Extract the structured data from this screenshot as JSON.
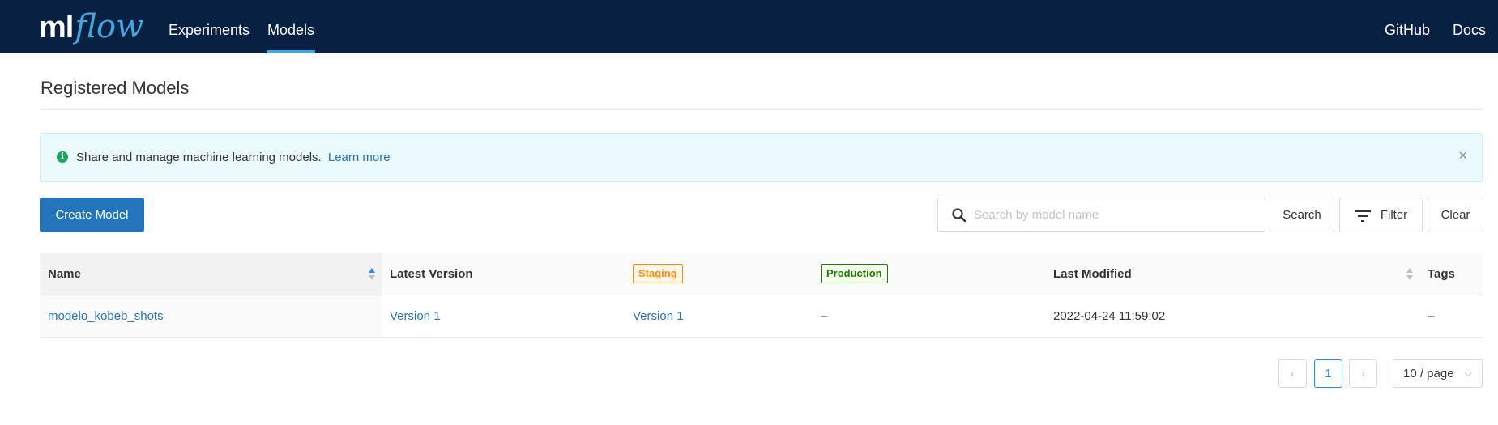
{
  "header": {
    "logo": {
      "ml": "ml",
      "flow": "flow"
    },
    "nav": {
      "experiments": "Experiments",
      "models": "Models",
      "github": "GitHub",
      "docs": "Docs"
    },
    "active": "Models"
  },
  "page": {
    "title": "Registered Models"
  },
  "alert": {
    "text": "Share and manage machine learning models.",
    "link": "Learn more",
    "icon": "info-icon",
    "close": "×"
  },
  "toolbar": {
    "create_label": "Create Model",
    "search_placeholder": "Search by model name",
    "search_value": "",
    "search_label": "Search",
    "filter_label": "Filter",
    "clear_label": "Clear"
  },
  "table": {
    "columns": {
      "name": "Name",
      "latest": "Latest Version",
      "staging": "Staging",
      "production": "Production",
      "modified": "Last Modified",
      "tags": "Tags"
    },
    "rows": [
      {
        "name": "modelo_kobeb_shots",
        "latest": "Version 1",
        "staging": "Version 1",
        "production": "–",
        "modified": "2022-04-24 11:59:02",
        "tags": "–"
      }
    ]
  },
  "pagination": {
    "prev": "‹",
    "current": "1",
    "next": "›",
    "page_size": "10 / page",
    "chevron": "⌵"
  },
  "colors": {
    "header_bg": "#082142",
    "accent": "#43a6e0",
    "primary": "#2374bb",
    "staging": "#fa8c16",
    "production": "#237804"
  }
}
